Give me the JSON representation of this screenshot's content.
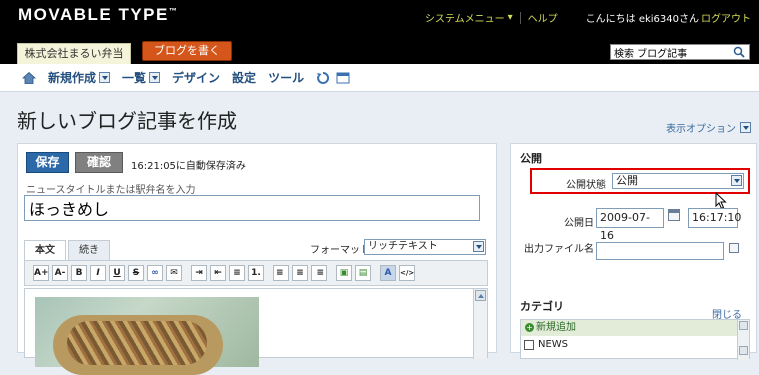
{
  "header": {
    "logo": "MOVABLE TYPE",
    "logo_tm": "™",
    "system_menu": "システムメニュー",
    "help": "ヘルプ",
    "greeting": "こんにちは eki6340さん",
    "logout": "ログアウト",
    "blog_name": "株式会社まるい弁当",
    "write_blog": "ブログを書く",
    "search_value": "検索 ブログ記事"
  },
  "menu": {
    "new_create": "新規作成",
    "list": "一覧",
    "design": "デザイン",
    "settings": "設定",
    "tools": "ツール"
  },
  "page": {
    "title": "新しいブログ記事を作成",
    "display_options": "表示オプション"
  },
  "editor": {
    "save": "保存",
    "preview": "確認",
    "autosave_status": "16:21:05に自動保存済み",
    "title_label": "ニュースタイトルまたは駅弁名を入力",
    "title_value": "ほっきめし",
    "tab_body": "本文",
    "tab_more": "続き",
    "format_label": "フォーマット:",
    "format_value": "リッチテキスト",
    "toolbar": {
      "font_bigger": "A+",
      "font_smaller": "A-",
      "bold": "B",
      "italic": "I",
      "underline": "U",
      "strike": "S",
      "link": "∞",
      "email": "✉",
      "indent": "⇥",
      "outdent": "⇤",
      "ul": "≡",
      "ol": "1.",
      "align_left": "≡",
      "align_center": "≡",
      "align_right": "≡",
      "image": "▣",
      "file": "▤",
      "text_color": "A",
      "html_toggle": "</>"
    }
  },
  "publish": {
    "heading": "公開",
    "status_label": "公開状態",
    "status_value": "公開",
    "date_label": "公開日",
    "date_value": "2009-07-16",
    "time_value": "16:17:10",
    "output_file_label": "出力ファイル名",
    "output_file_value": ""
  },
  "category": {
    "heading": "カテゴリ",
    "close": "閉じる",
    "add_new": "新規追加",
    "items": [
      "NEWS"
    ]
  }
}
